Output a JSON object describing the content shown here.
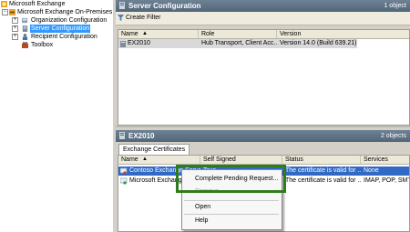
{
  "tree": {
    "items": [
      {
        "label": "Microsoft Exchange",
        "icon": "exchange-icon"
      },
      {
        "label": "Microsoft Exchange On-Premises (e",
        "icon": "exchange-server-icon"
      },
      {
        "label": "Organization Configuration",
        "icon": "organization-icon"
      },
      {
        "label": "Server Configuration",
        "icon": "server-icon"
      },
      {
        "label": "Recipient Configuration",
        "icon": "recipient-icon"
      },
      {
        "label": "Toolbox",
        "icon": "toolbox-icon"
      }
    ]
  },
  "server_config": {
    "title": "Server Configuration",
    "count": "1 object",
    "toolbar_create_filter": "Create Filter",
    "columns": [
      "Name",
      "Role",
      "Version"
    ],
    "rows": [
      {
        "name": "EX2010",
        "role": "Hub Transport, Client Acc...",
        "version": "Version 14.0 (Build 639.21)"
      }
    ]
  },
  "details": {
    "title": "EX2010",
    "count": "2 objects",
    "tab": "Exchange Certificates",
    "columns": [
      "Name",
      "Self Signed",
      "Status",
      "Services"
    ],
    "rows": [
      {
        "name": "Contoso Exchange Server",
        "self_signed": "True",
        "status": "The certificate is valid for ...",
        "services": "None"
      },
      {
        "name": "Microsoft Exchange",
        "self_signed": "",
        "status": "The certificate is valid for ...",
        "services": "IMAP, POP, SMTP"
      }
    ]
  },
  "context_menu": {
    "items": [
      "Complete Pending Request...",
      "Remove",
      "Open",
      "Help"
    ]
  },
  "colors": {
    "header_bg": "#5d7185",
    "selection": "#316ac5",
    "highlight_box": "#2e7d1b"
  }
}
